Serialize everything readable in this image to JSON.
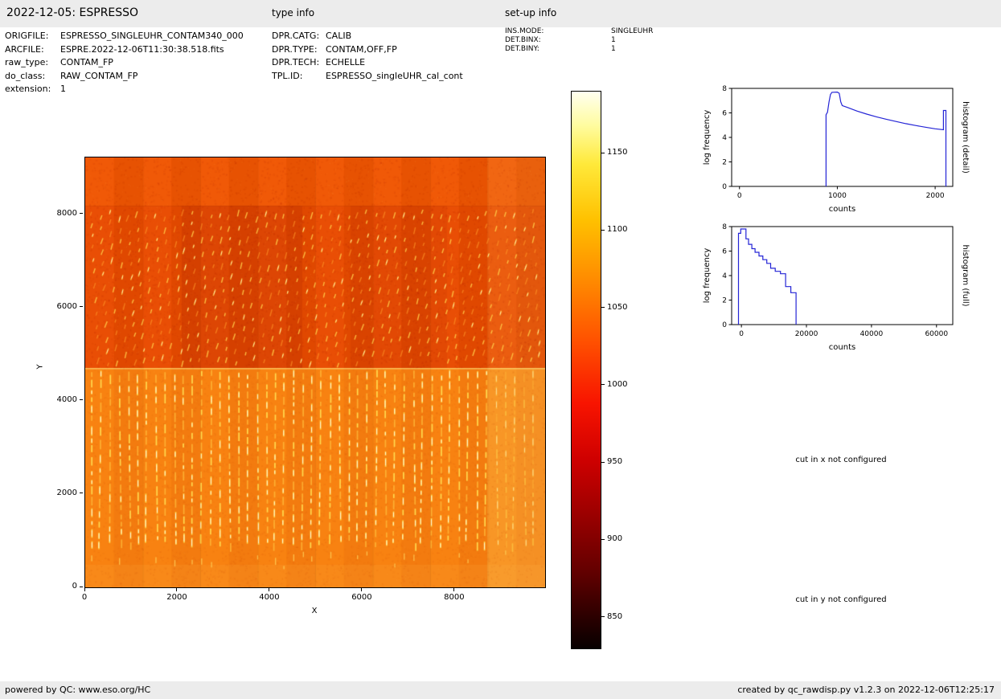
{
  "header": {
    "title": "2022-12-05: ESPRESSO",
    "type_info_label": "type info",
    "setup_info_label": "set-up info"
  },
  "metadata": {
    "left": [
      {
        "label": "ORIGFILE:",
        "value": "ESPRESSO_SINGLEUHR_CONTAM340_000"
      },
      {
        "label": "ARCFILE:",
        "value": "ESPRE.2022-12-06T11:30:38.518.fits"
      },
      {
        "label": "raw_type:",
        "value": "CONTAM_FP"
      },
      {
        "label": "do_class:",
        "value": "RAW_CONTAM_FP"
      },
      {
        "label": "extension:",
        "value": "1"
      }
    ],
    "type": [
      {
        "label": "DPR.CATG:",
        "value": "CALIB"
      },
      {
        "label": "DPR.TYPE:",
        "value": "CONTAM,OFF,FP"
      },
      {
        "label": "DPR.TECH:",
        "value": "ECHELLE"
      },
      {
        "label": "TPL.ID:",
        "value": "ESPRESSO_singleUHR_cal_cont"
      }
    ],
    "setup": [
      {
        "label": "INS.MODE:",
        "value": "SINGLEUHR"
      },
      {
        "label": "DET.BINX:",
        "value": "1"
      },
      {
        "label": "DET.BINY:",
        "value": "1"
      }
    ]
  },
  "notes": {
    "cut_x": "cut in x not configured",
    "cut_y": "cut in y not configured"
  },
  "footer": {
    "left": "powered by QC: www.eso.org/HC",
    "right": "created by qc_rawdisp.py v1.2.3 on 2022-12-06T12:25:17"
  },
  "chart_data": [
    {
      "type": "heatmap",
      "name": "raw detector image",
      "xlabel": "X",
      "ylabel": "Y",
      "xlim": [
        0,
        9950
      ],
      "ylim": [
        0,
        9224
      ],
      "xticks": [
        0,
        2000,
        4000,
        6000,
        8000
      ],
      "yticks": [
        0,
        2000,
        4000,
        6000,
        8000
      ],
      "colorbar": {
        "colormap": "hot",
        "vmin": 830,
        "vmax": 1190,
        "ticks": [
          1150,
          1100,
          1050,
          1000,
          950,
          900,
          850
        ]
      },
      "palette": {
        "upper_band": "#f05603",
        "upper": "#e94b00",
        "lower": "#f87e10",
        "fringe": "#ffd94e",
        "fringe_core": "#fff6d8"
      },
      "description": "ESPRESSO raw CONTAM_FP frame: orange background near 1000 counts; upper half darker (~970), lower half brighter (~1040); dense comb of ~49 columns of short bright Fabry-Perot fringe dashes, slanted in the upper half (y~4700-8200) and vertical in the lower half (y~900-4700); plain bands at very top and bottom; right-edge columns lighter"
    },
    {
      "type": "line",
      "name": "histogram (detail)",
      "xlabel": "counts",
      "ylabel": "log frequency",
      "xlim": [
        -80,
        2180
      ],
      "ylim": [
        0,
        8
      ],
      "xticks": [
        0,
        1000,
        2000
      ],
      "yticks": [
        0,
        2,
        4,
        6,
        8
      ],
      "line_color": "#2424d6",
      "points": [
        [
          885,
          0
        ],
        [
          885,
          5.85
        ],
        [
          900,
          6.05
        ],
        [
          915,
          6.9
        ],
        [
          930,
          7.5
        ],
        [
          945,
          7.68
        ],
        [
          1000,
          7.7
        ],
        [
          1020,
          7.6
        ],
        [
          1035,
          6.9
        ],
        [
          1050,
          6.6
        ],
        [
          1100,
          6.45
        ],
        [
          1200,
          6.15
        ],
        [
          1300,
          5.9
        ],
        [
          1400,
          5.68
        ],
        [
          1500,
          5.48
        ],
        [
          1600,
          5.3
        ],
        [
          1700,
          5.12
        ],
        [
          1800,
          4.97
        ],
        [
          1900,
          4.83
        ],
        [
          2000,
          4.7
        ],
        [
          2085,
          4.62
        ],
        [
          2085,
          6.2
        ],
        [
          2110,
          6.2
        ],
        [
          2110,
          0
        ]
      ]
    },
    {
      "type": "line",
      "name": "histogram (full)",
      "xlabel": "counts",
      "ylabel": "log frequency",
      "xlim": [
        -3000,
        65000
      ],
      "ylim": [
        0,
        8
      ],
      "xticks": [
        0,
        20000,
        40000,
        60000
      ],
      "yticks": [
        0,
        2,
        4,
        6,
        8
      ],
      "line_color": "#2424d6",
      "points": [
        [
          -900,
          0
        ],
        [
          -900,
          7.45
        ],
        [
          -200,
          7.45
        ],
        [
          -200,
          7.8
        ],
        [
          1400,
          7.8
        ],
        [
          1400,
          7.0
        ],
        [
          2200,
          7.0
        ],
        [
          2200,
          6.55
        ],
        [
          3200,
          6.55
        ],
        [
          3200,
          6.2
        ],
        [
          4200,
          6.2
        ],
        [
          4200,
          5.9
        ],
        [
          5400,
          5.9
        ],
        [
          5400,
          5.6
        ],
        [
          6600,
          5.6
        ],
        [
          6600,
          5.3
        ],
        [
          7800,
          5.3
        ],
        [
          7800,
          5.0
        ],
        [
          9000,
          5.0
        ],
        [
          9000,
          4.6
        ],
        [
          10400,
          4.6
        ],
        [
          10400,
          4.35
        ],
        [
          12000,
          4.35
        ],
        [
          12000,
          4.15
        ],
        [
          13600,
          4.15
        ],
        [
          13600,
          3.1
        ],
        [
          15200,
          3.1
        ],
        [
          15200,
          2.6
        ],
        [
          16800,
          2.6
        ],
        [
          16800,
          0
        ]
      ]
    }
  ]
}
